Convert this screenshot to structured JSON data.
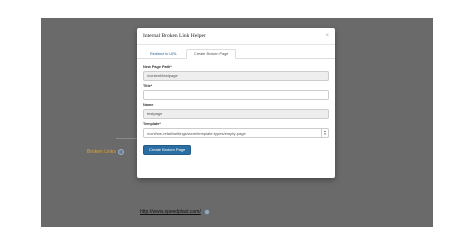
{
  "modal": {
    "title": "Internal Broken Link Helper",
    "close_glyph": "×"
  },
  "tabs": [
    {
      "label": "Redirect to URL",
      "active": false
    },
    {
      "label": "Create Broken Page",
      "active": true
    }
  ],
  "form": {
    "page_path_label": "New Page Path*",
    "page_path_value": "/content/testpage",
    "title_label": "Title*",
    "title_value": "",
    "name_label": "Name",
    "name_value": "testpage",
    "template_label": "Template*",
    "template_value": "/conf/we-retail/settings/wcm/template-types/empty-page",
    "submit_label": "Create Broken Page"
  },
  "canvas": {
    "broken_link_label": "Broken Links",
    "url_label": "http://www.speedplast.com/"
  },
  "colors": {
    "canvas_bg": "#6a6a6a",
    "primary_button": "#2b6ea3",
    "broken_link_text": "#d9a23a",
    "tab_link": "#2a6496"
  }
}
